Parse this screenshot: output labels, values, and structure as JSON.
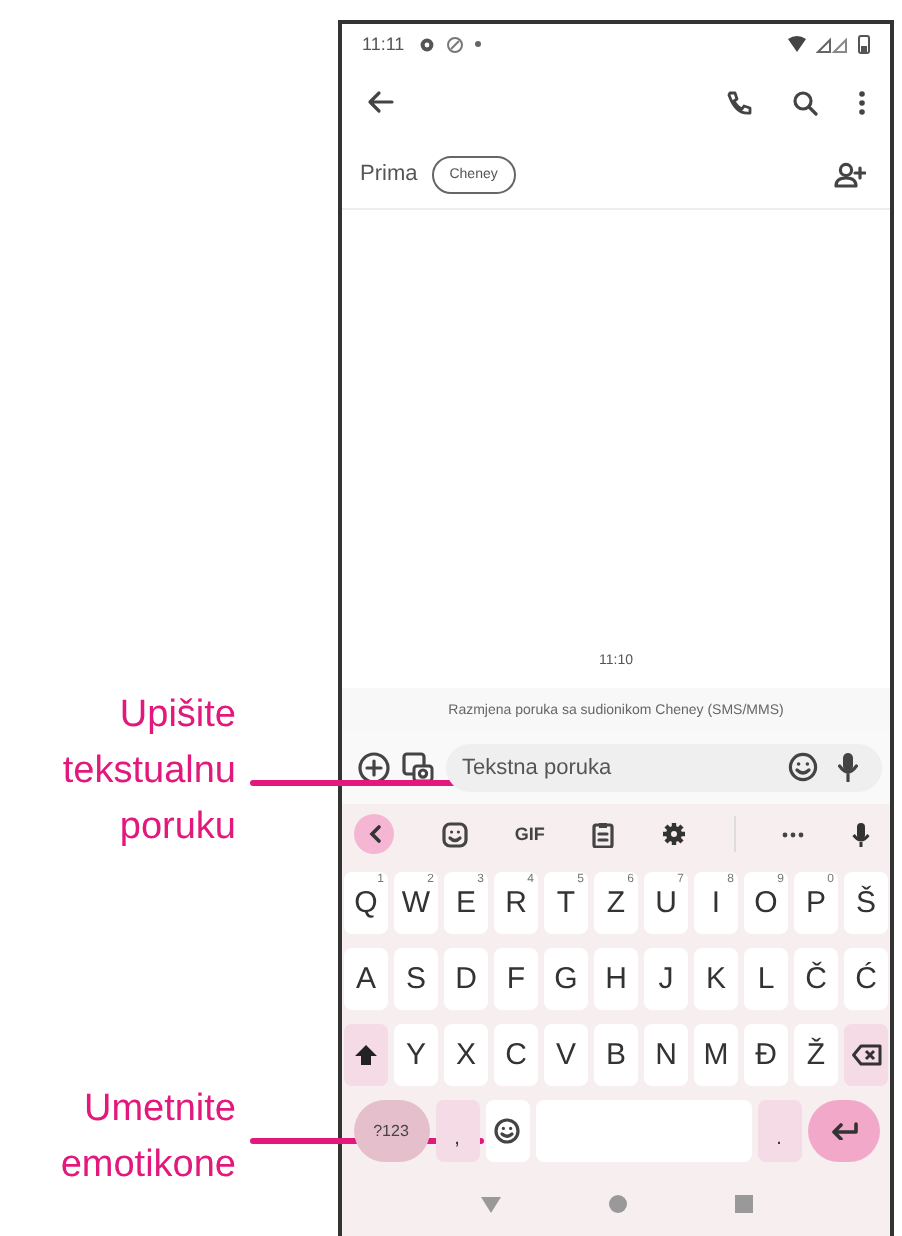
{
  "callouts": [
    {
      "lines": [
        "Upišite",
        "tekstualnu",
        "poruku"
      ]
    },
    {
      "lines": [
        "Umetnite",
        "emotikone"
      ]
    }
  ],
  "status_bar": {
    "time": "11:11"
  },
  "recipients": {
    "label": "Prima",
    "chips": [
      "Cheney"
    ]
  },
  "conversation": {
    "time": "11:10",
    "info": "Razmjena poruka sa sudionikom Cheney (SMS/MMS)"
  },
  "compose": {
    "placeholder": "Tekstna poruka"
  },
  "keyboard": {
    "toolbar": [
      {
        "kind": "back"
      },
      {
        "kind": "sticker"
      },
      {
        "kind": "text",
        "label": "GIF"
      },
      {
        "kind": "clipboard"
      },
      {
        "kind": "settings"
      },
      {
        "kind": "divider"
      },
      {
        "kind": "more"
      },
      {
        "kind": "mic"
      }
    ],
    "rows": [
      [
        {
          "kind": "char",
          "label": "Q",
          "hint": "1"
        },
        {
          "kind": "char",
          "label": "W",
          "hint": "2"
        },
        {
          "kind": "char",
          "label": "E",
          "hint": "3"
        },
        {
          "kind": "char",
          "label": "R",
          "hint": "4"
        },
        {
          "kind": "char",
          "label": "T",
          "hint": "5"
        },
        {
          "kind": "char",
          "label": "Z",
          "hint": "6"
        },
        {
          "kind": "char",
          "label": "U",
          "hint": "7"
        },
        {
          "kind": "char",
          "label": "I",
          "hint": "8"
        },
        {
          "kind": "char",
          "label": "O",
          "hint": "9"
        },
        {
          "kind": "char",
          "label": "P",
          "hint": "0"
        },
        {
          "kind": "char",
          "label": "Š"
        }
      ],
      [
        {
          "kind": "char",
          "label": "A"
        },
        {
          "kind": "char",
          "label": "S"
        },
        {
          "kind": "char",
          "label": "D"
        },
        {
          "kind": "char",
          "label": "F"
        },
        {
          "kind": "char",
          "label": "G"
        },
        {
          "kind": "char",
          "label": "H"
        },
        {
          "kind": "char",
          "label": "J"
        },
        {
          "kind": "char",
          "label": "K"
        },
        {
          "kind": "char",
          "label": "L"
        },
        {
          "kind": "char",
          "label": "Č"
        },
        {
          "kind": "char",
          "label": "Ć"
        }
      ],
      [
        {
          "kind": "shift"
        },
        {
          "kind": "char",
          "label": "Y"
        },
        {
          "kind": "char",
          "label": "X"
        },
        {
          "kind": "char",
          "label": "C"
        },
        {
          "kind": "char",
          "label": "V"
        },
        {
          "kind": "char",
          "label": "B"
        },
        {
          "kind": "char",
          "label": "N"
        },
        {
          "kind": "char",
          "label": "M"
        },
        {
          "kind": "char",
          "label": "Đ"
        },
        {
          "kind": "char",
          "label": "Ž"
        },
        {
          "kind": "backspace"
        }
      ],
      [
        {
          "kind": "symbols",
          "label": "?123"
        },
        {
          "kind": "punct",
          "label": ","
        },
        {
          "kind": "emoji"
        },
        {
          "kind": "space"
        },
        {
          "kind": "punct",
          "label": "."
        },
        {
          "kind": "enter"
        }
      ]
    ]
  }
}
